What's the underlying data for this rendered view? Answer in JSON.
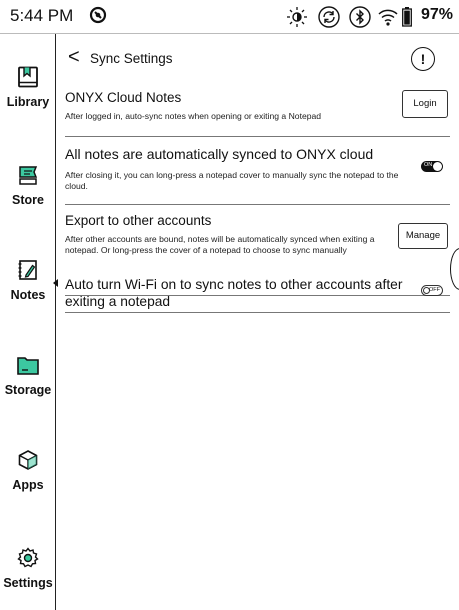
{
  "status_bar": {
    "time": "5:44 PM",
    "battery": "97%",
    "icons": [
      "sync-app-icon",
      "brightness-icon",
      "refresh-icon",
      "bluetooth-icon",
      "wifi-icon",
      "battery-icon"
    ]
  },
  "sidebar": {
    "items": [
      {
        "label": "Library",
        "icon": "library-icon"
      },
      {
        "label": "Store",
        "icon": "store-icon"
      },
      {
        "label": "Notes",
        "icon": "notes-icon",
        "active": true
      },
      {
        "label": "Storage",
        "icon": "storage-icon"
      },
      {
        "label": "Apps",
        "icon": "apps-icon"
      },
      {
        "label": "Settings",
        "icon": "settings-icon"
      }
    ],
    "accent_color": "#3cc8a0"
  },
  "header": {
    "back_glyph": "<",
    "title": "Sync Settings",
    "info_glyph": "!"
  },
  "settings": {
    "cloud_notes": {
      "title": "ONYX Cloud Notes",
      "description": "After logged in, auto-sync notes when opening or exiting a Notepad",
      "button_label": "Login"
    },
    "auto_sync": {
      "title": "All notes are automatically synced to ONYX cloud",
      "description": "After closing it, you can long-press a notepad cover to manually sync the notepad to the cloud.",
      "toggle_label": "ON",
      "toggle_state": true
    },
    "export": {
      "title": "Export to other accounts",
      "description": "After other accounts are bound, notes will be automatically synced when exiting a notepad. Or long-press the cover of a notepad to choose to sync manually",
      "button_label": "Manage"
    },
    "wifi": {
      "title": "Auto turn Wi-Fi on to sync notes to other accounts after exiting a notepad",
      "toggle_label": "OFF",
      "toggle_state": false
    }
  }
}
